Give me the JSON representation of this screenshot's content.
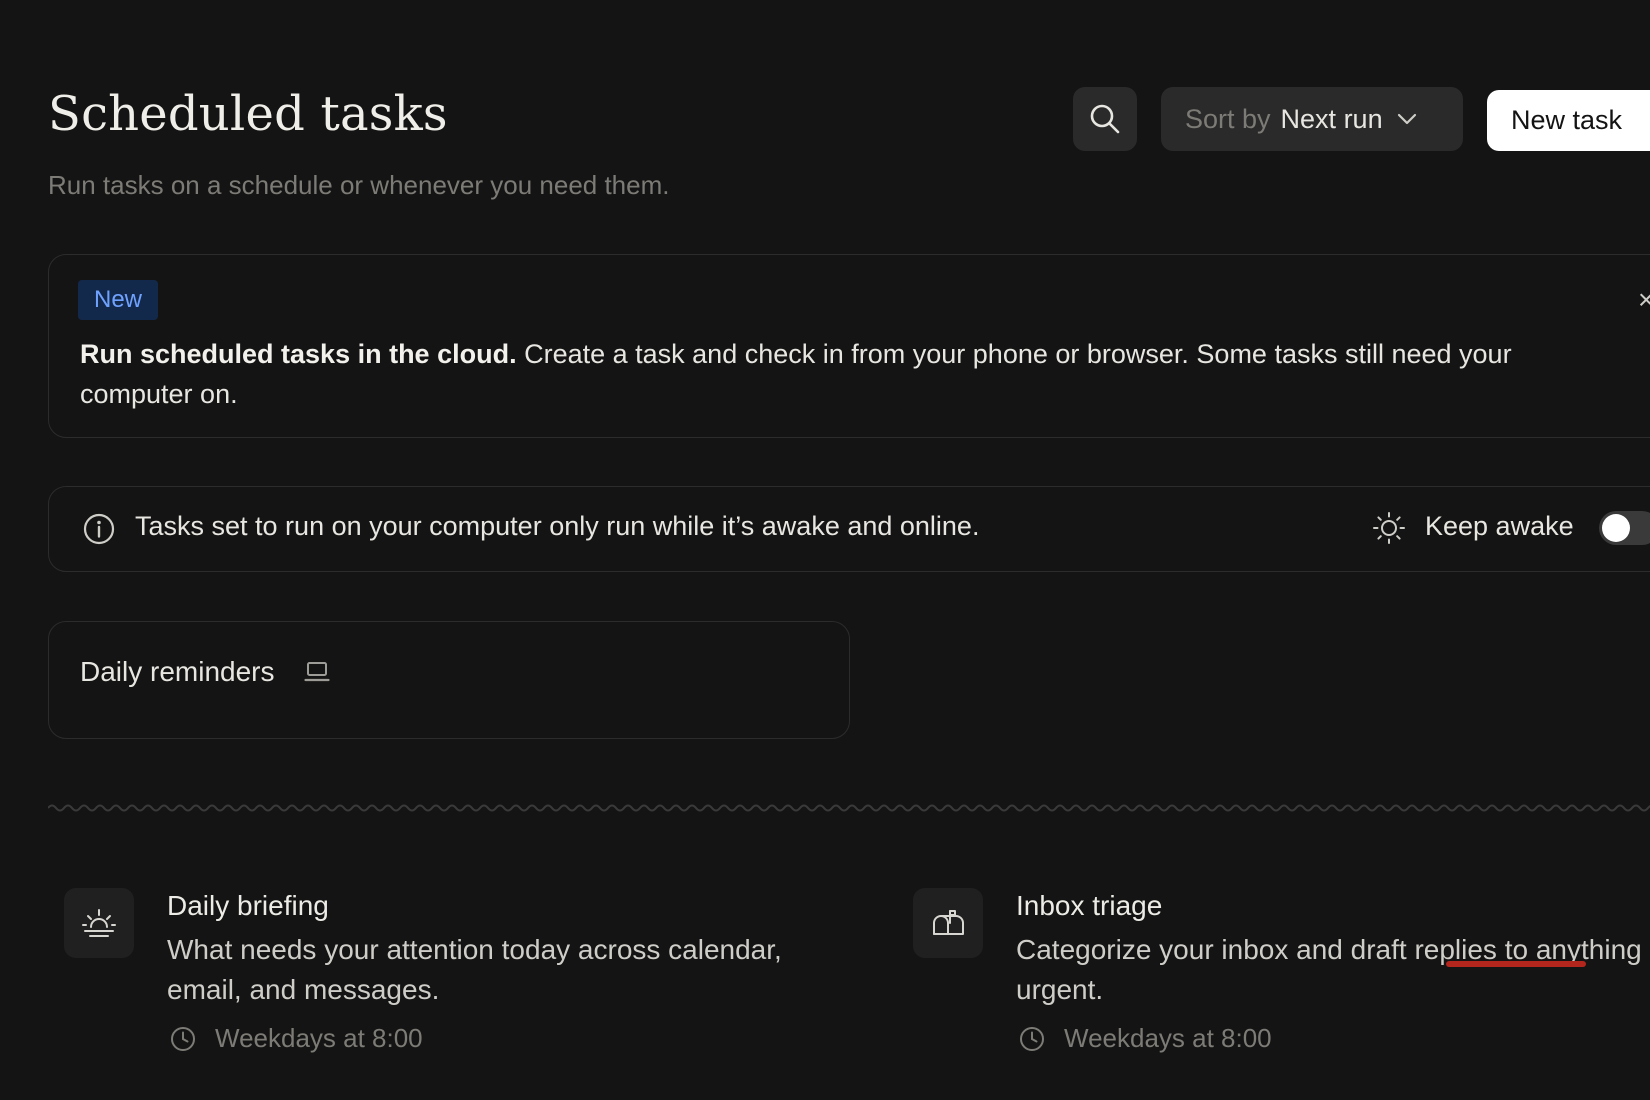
{
  "header": {
    "title": "Scheduled tasks",
    "subtitle": "Run tasks on a schedule or whenever you need them.",
    "sort_prefix": "Sort by",
    "sort_value": "Next run",
    "new_task_label": "New task"
  },
  "banner": {
    "badge": "New",
    "headline": "Run scheduled tasks in the cloud.",
    "body": " Create a task and check in from your phone or browser. Some tasks still need your computer on.",
    "close_glyph": "×"
  },
  "info": {
    "text": "Tasks set to run on your computer only run while it’s awake and online.",
    "keep_awake_label": "Keep awake",
    "keep_awake_on": false
  },
  "tasks": [
    {
      "name": "Daily reminders",
      "location_icon": "laptop-icon"
    }
  ],
  "templates": [
    {
      "icon": "sunrise-icon",
      "title": "Daily briefing",
      "description": "What needs your attention today across calendar, email, and messages.",
      "schedule": "Weekdays at 8:00"
    },
    {
      "icon": "mailbox-icon",
      "title": "Inbox triage",
      "description": "Categorize your inbox and draft replies to anything urgent.",
      "schedule": "Weekdays at 8:00"
    }
  ],
  "colors": {
    "background": "#141414",
    "badge_bg": "#13294b",
    "badge_text": "#6fa2ff",
    "primary_button_bg": "#ffffff"
  }
}
